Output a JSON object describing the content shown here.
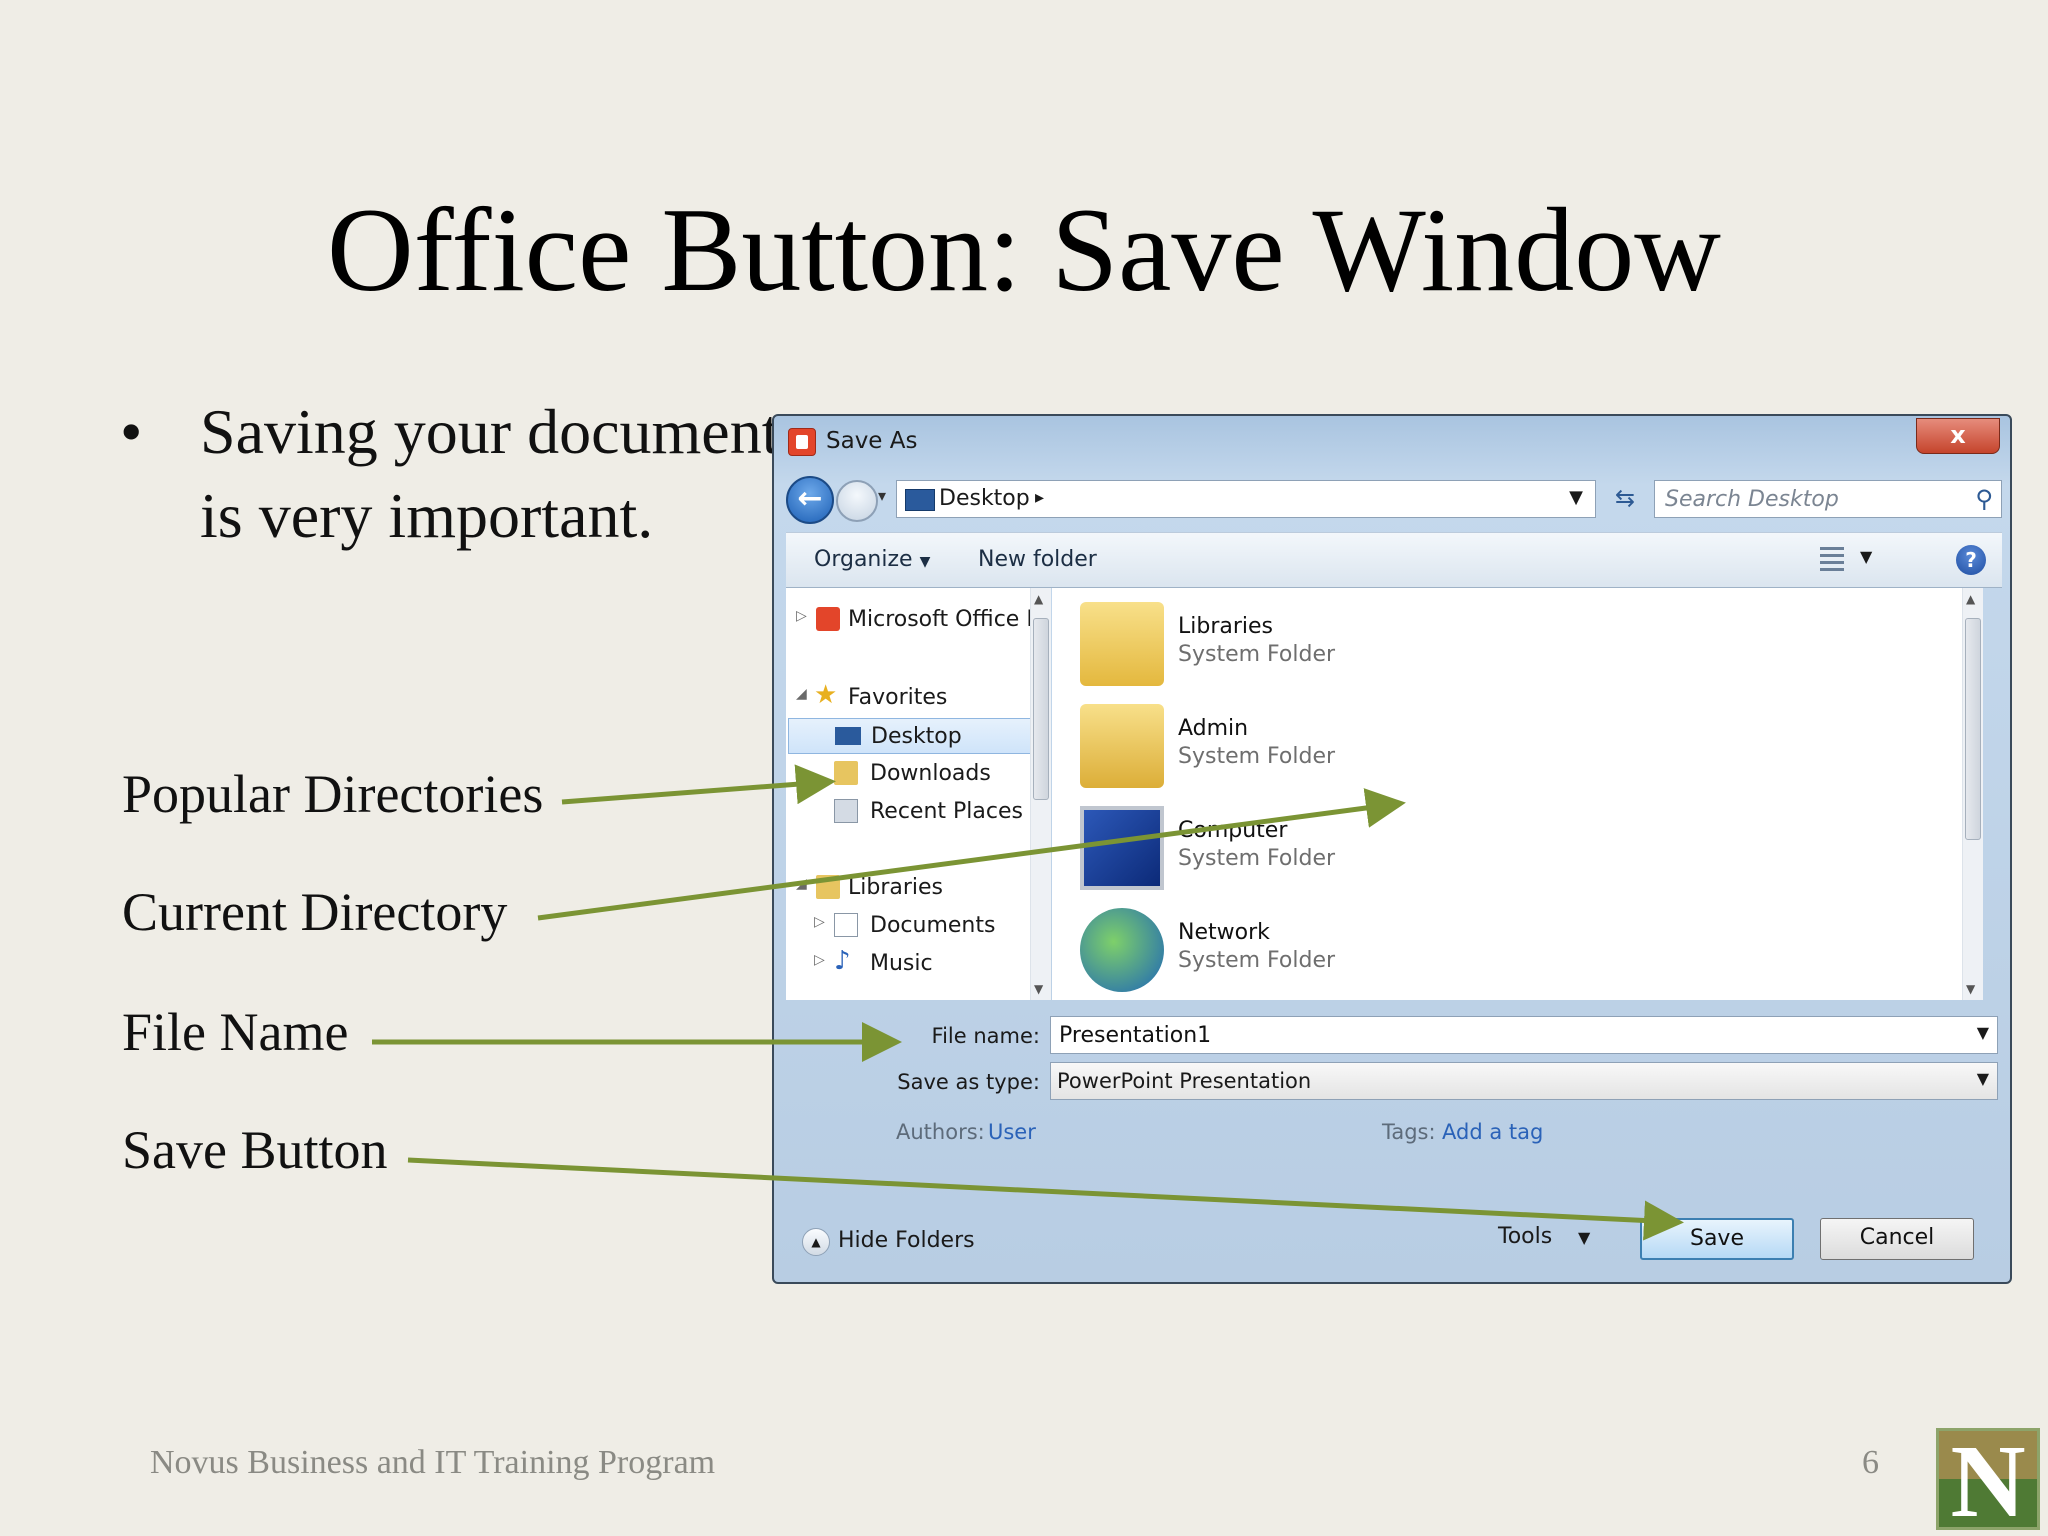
{
  "slide": {
    "title": "Office Button: Save Window",
    "bullet": "Saving your document is very important.",
    "callouts": [
      "Popular Directories",
      "Current Directory",
      "File Name",
      "Save Button"
    ],
    "footer": "Novus Business and IT Training Program",
    "page_number": "6",
    "logo_letter": "N",
    "arrow_color": "#7b9434"
  },
  "dialog": {
    "title": "Save As",
    "close_label": "x",
    "address": {
      "location": "Desktop"
    },
    "search": {
      "placeholder": "Search Desktop"
    },
    "toolbar": {
      "organize": "Organize",
      "new_folder": "New folder"
    },
    "nav_items": [
      {
        "label": "Microsoft Office PowerPoint",
        "icon": "office-icon"
      },
      {
        "label": "Favorites",
        "icon": "star-icon"
      },
      {
        "label": "Desktop",
        "icon": "desktop-icon",
        "selected": true
      },
      {
        "label": "Downloads",
        "icon": "downloads-folder-icon"
      },
      {
        "label": "Recent Places",
        "icon": "recent-places-icon"
      },
      {
        "label": "Libraries",
        "icon": "libraries-icon"
      },
      {
        "label": "Documents",
        "icon": "documents-icon"
      },
      {
        "label": "Music",
        "icon": "music-icon"
      }
    ],
    "items": [
      {
        "name": "Libraries",
        "type": "System Folder",
        "icon": "libraries-folder-icon"
      },
      {
        "name": "Admin",
        "type": "System Folder",
        "icon": "user-folder-icon"
      },
      {
        "name": "Computer",
        "type": "System Folder",
        "icon": "computer-icon"
      },
      {
        "name": "Network",
        "type": "System Folder",
        "icon": "network-icon"
      }
    ],
    "file_name_label": "File name:",
    "file_name_value": "Presentation1",
    "save_type_label": "Save as type:",
    "save_type_value": "PowerPoint Presentation",
    "authors_label": "Authors:",
    "authors_value": "User",
    "tags_label": "Tags:",
    "tags_value": "Add a tag",
    "hide_folders": "Hide Folders",
    "tools": "Tools",
    "save": "Save",
    "cancel": "Cancel"
  }
}
